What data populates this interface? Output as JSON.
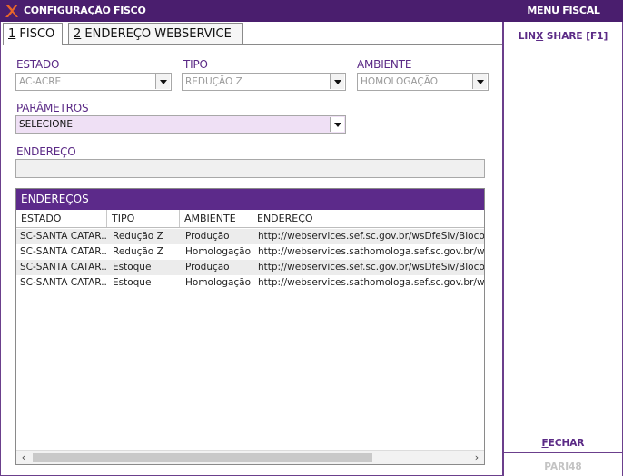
{
  "window": {
    "title": "CONFIGURAÇÃO FISCO",
    "menu_title": "MENU FISCAL"
  },
  "tabs": [
    {
      "key": "1",
      "label": " FISCO"
    },
    {
      "key": "2",
      "label": " ENDEREÇO WEBSERVICE"
    }
  ],
  "form": {
    "estado": {
      "label": "ESTADO",
      "value": "AC-ACRE"
    },
    "tipo": {
      "label": "TIPO",
      "value": "REDUÇÃO Z"
    },
    "ambiente": {
      "label": "AMBIENTE",
      "value": "HOMOLOGAÇÃO"
    },
    "parametros": {
      "label": "PARÂMETROS",
      "value": "SELECIONE"
    },
    "endereco": {
      "label": "ENDEREÇO",
      "value": ""
    }
  },
  "grid": {
    "title": "ENDEREÇOS",
    "columns": [
      "ESTADO",
      "TIPO",
      "AMBIENTE",
      "ENDEREÇO"
    ],
    "rows": [
      [
        "SC-SANTA CATAR...",
        "Redução Z",
        "Produção",
        "http://webservices.sef.sc.gov.br/wsDfeSiv/BlocoX.a"
      ],
      [
        "SC-SANTA CATAR...",
        "Redução Z",
        "Homologação",
        "http://webservices.sathomologa.sef.sc.gov.br/wsDf"
      ],
      [
        "SC-SANTA CATAR...",
        "Estoque",
        "Produção",
        "http://webservices.sef.sc.gov.br/wsDfeSiv/BlocoX.a"
      ],
      [
        "SC-SANTA CATAR...",
        "Estoque",
        "Homologação",
        "http://webservices.sathomologa.sef.sc.gov.br/wsDf"
      ]
    ]
  },
  "side": {
    "linx_prefix": "LIN",
    "linx_key": "X",
    "linx_suffix": " SHARE [F1]",
    "fechar_key": "F",
    "fechar_rest": "ECHAR",
    "code": "PARI48"
  },
  "colors": {
    "brand": "#4a1e6e",
    "accent": "#5c2a8a"
  }
}
